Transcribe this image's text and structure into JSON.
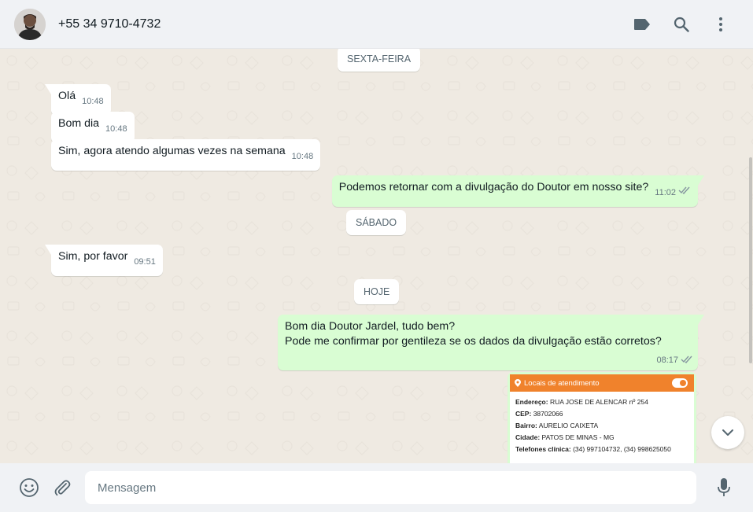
{
  "header": {
    "contact_name": "+55 34 9710-4732",
    "icons": [
      "label-icon",
      "search-icon",
      "menu-kebab-icon"
    ]
  },
  "chat": {
    "date_dividers": [
      "SEXTA-FEIRA",
      "SÁBADO",
      "HOJE"
    ],
    "messages": [
      {
        "direction": "in",
        "text": "Olá",
        "time": "10:48"
      },
      {
        "direction": "in",
        "text": "Bom dia",
        "time": "10:48"
      },
      {
        "direction": "in",
        "text": "Sim, agora atendo algumas vezes na semana",
        "time": "10:48"
      },
      {
        "direction": "out",
        "text": "Podemos retornar com a divulgação do Doutor em nosso site?",
        "time": "11:02",
        "status": "read"
      },
      {
        "direction": "in",
        "text": "Sim, por favor",
        "time": "09:51"
      },
      {
        "direction": "out",
        "line1": "Bom dia Doutor Jardel, tudo bem?",
        "line2": "Pode me confirmar por gentileza se os dados da divulgação estão corretos?",
        "time": "08:17",
        "status": "read"
      }
    ],
    "image_card": {
      "title": "Locais de atendimento",
      "rows": [
        {
          "label": "Endereço:",
          "value": "RUA JOSE DE ALENCAR nº 254"
        },
        {
          "label": "CEP:",
          "value": "38702066"
        },
        {
          "label": "Bairro:",
          "value": "AURELIO CAIXETA"
        },
        {
          "label": "Cidade:",
          "value": "PATOS DE MINAS - MG"
        },
        {
          "label": "Telefones clínica:",
          "value": "(34) 997104732, (34) 998625050"
        }
      ]
    }
  },
  "footer": {
    "placeholder": "Mensagem"
  },
  "colors": {
    "outgoing_bubble": "#d9fdd3",
    "incoming_bubble": "#ffffff",
    "chat_background": "#efeae2",
    "read_ticks": "#8696a0",
    "card_header": "#f0822c"
  }
}
